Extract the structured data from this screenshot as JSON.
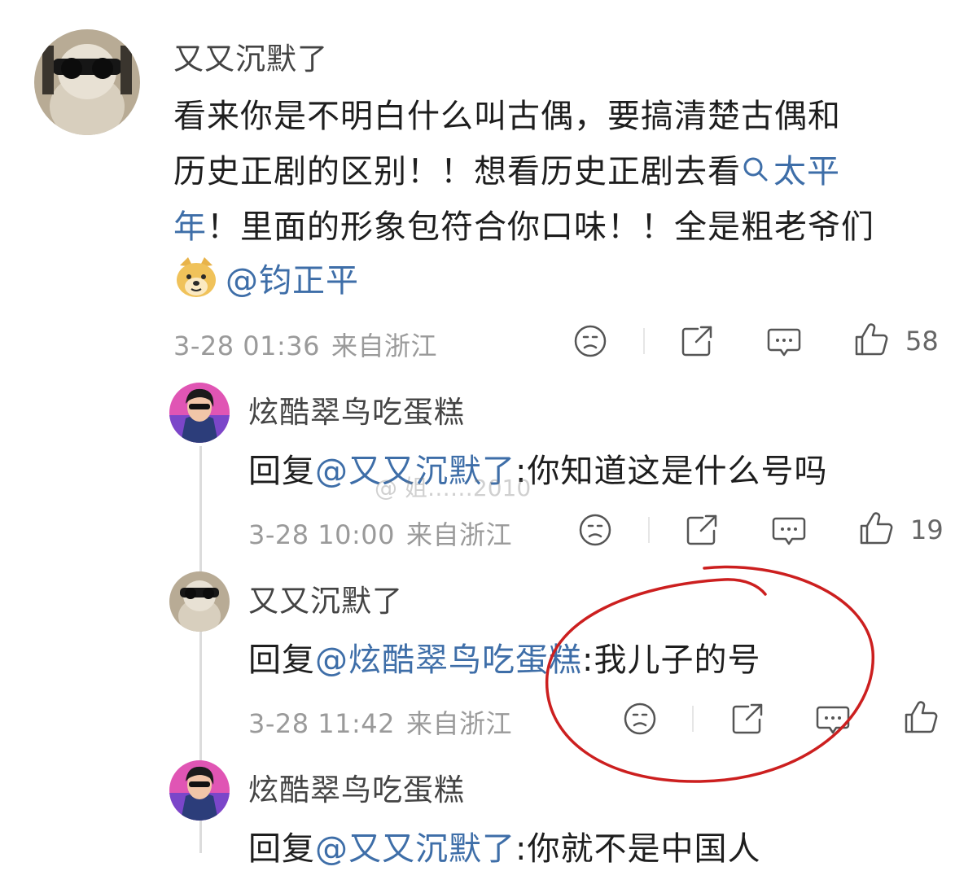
{
  "comment": {
    "username": "又又沉默了",
    "text_line1": "看来你是不明白什么叫古偶，要搞清楚古偶和",
    "text_line2_a": "历史正剧的区别！！想看历史正剧去看",
    "text_line2_link": "太平",
    "text_line3_link": "年",
    "text_line3_b": "！里面的形象包符合你口味！！全是粗老爷们",
    "text_line4": "@钧正平",
    "date": "3-28 01:36",
    "location": "来自浙江",
    "like_count": "58"
  },
  "replies": [
    {
      "username": "炫酷翠鸟吃蛋糕",
      "reply_prefix": "回复",
      "reply_to": "@又又沉默了",
      "text": ":你知道这是什么号吗",
      "date": "3-28 10:00",
      "location": "来自浙江",
      "like_count": "19"
    },
    {
      "username": "又又沉默了",
      "reply_prefix": "回复",
      "reply_to": "@炫酷翠鸟吃蛋糕",
      "text": ":我儿子的号",
      "date": "3-28 11:42",
      "location": "来自浙江",
      "like_count": ""
    },
    {
      "username": "炫酷翠鸟吃蛋糕",
      "reply_prefix": "回复",
      "reply_to": "@又又沉默了",
      "text": ":你就不是中国人"
    }
  ],
  "watermark": "@ 姐……2010",
  "icons": {
    "search": "search-icon",
    "emoji": "doge-emoji-icon",
    "dislike": "frown-face-icon",
    "share": "share-icon",
    "comment": "comment-icon",
    "like": "thumbs-up-icon"
  },
  "colors": {
    "link": "#3e6ea8",
    "meta": "#9a9a9a",
    "annotation": "#cc1f1f"
  }
}
